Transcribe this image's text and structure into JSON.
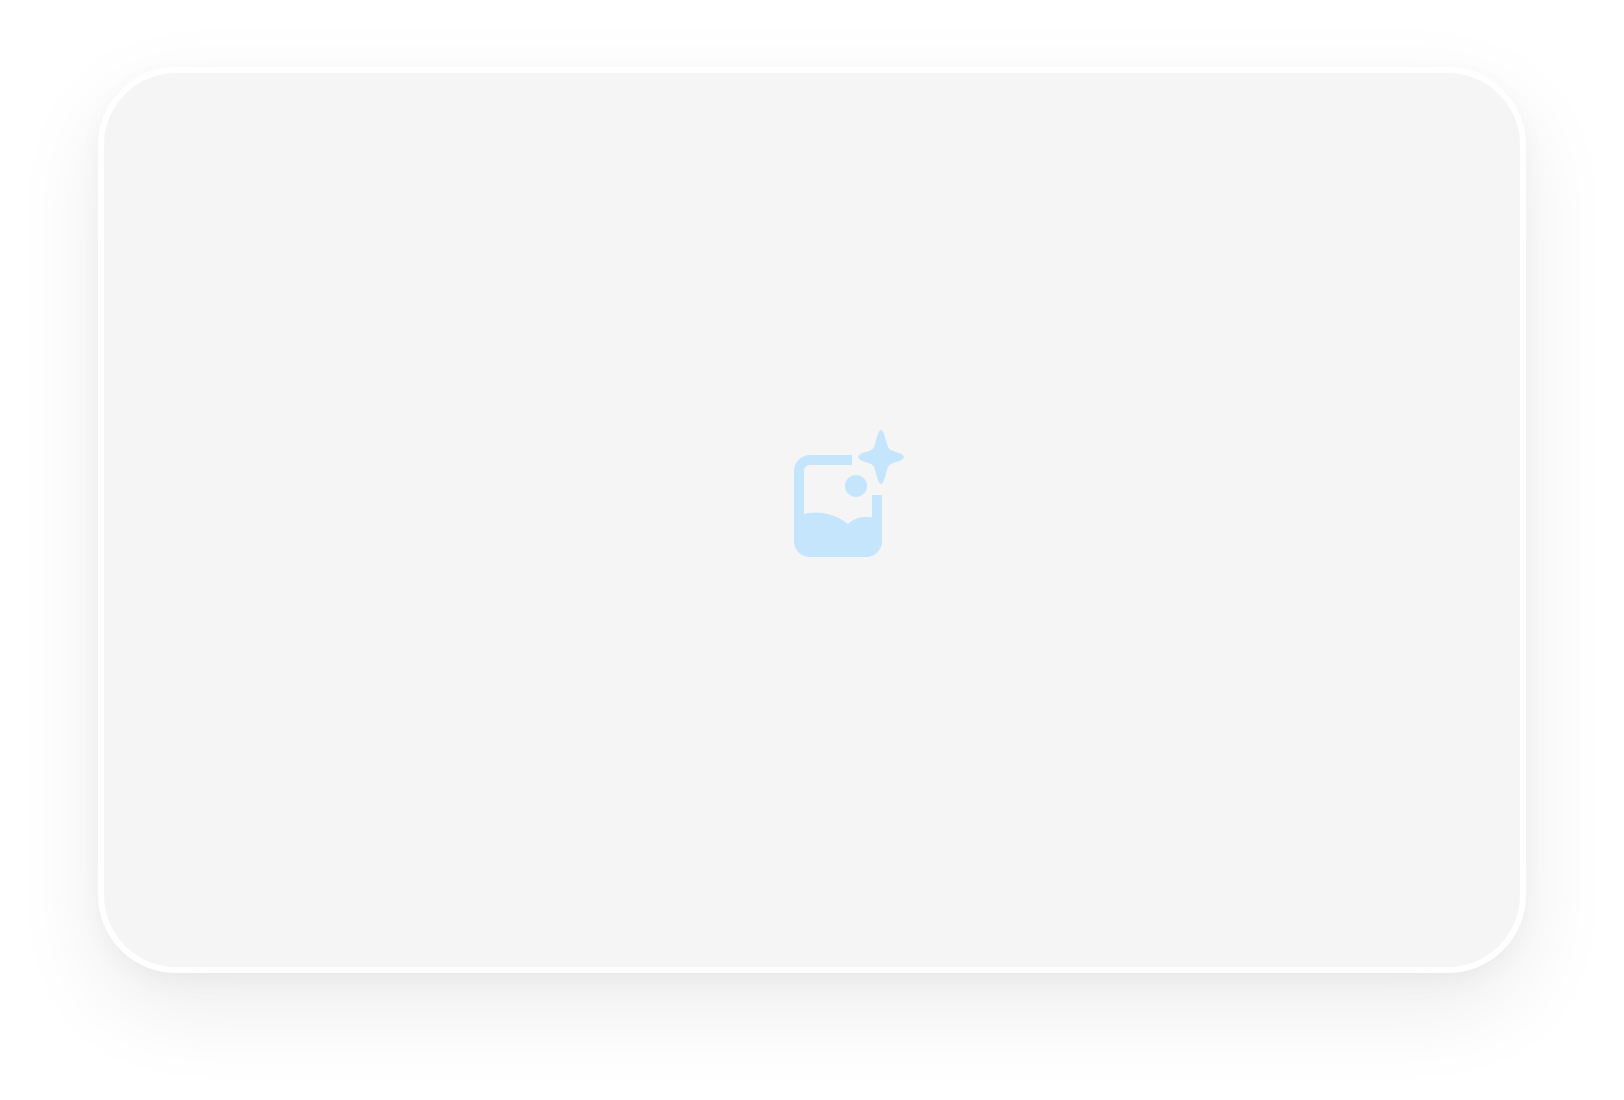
{
  "card": {
    "background": "#f5f5f5",
    "border_color": "#ffffff"
  },
  "placeholder": {
    "icon": "image-sparkle-icon",
    "color": "#c5e5fd"
  }
}
